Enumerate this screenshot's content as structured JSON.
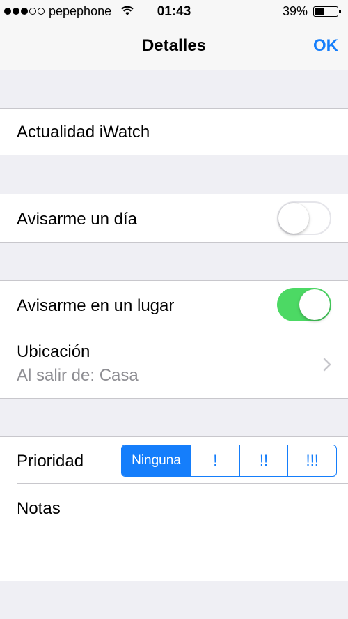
{
  "status_bar": {
    "carrier": "pepephone",
    "time": "01:43",
    "battery": "39%",
    "battery_level": 0.39,
    "signal_bars": 3,
    "signal_total": 5
  },
  "nav": {
    "title": "Detalles",
    "done_label": "OK"
  },
  "title_cell": {
    "text": "Actualidad iWatch"
  },
  "remind_day": {
    "label": "Avisarme un día",
    "on": false
  },
  "remind_location": {
    "label": "Avisarme en un lugar",
    "on": true,
    "location_label": "Ubicación",
    "location_value": "Al salir de: Casa"
  },
  "priority": {
    "label": "Prioridad",
    "options": [
      "Ninguna",
      "!",
      "!!",
      "!!!"
    ],
    "selected": "Ninguna"
  },
  "notes": {
    "label": "Notas"
  },
  "colors": {
    "accent": "#157efb",
    "toggle_on": "#4cd964",
    "background": "#efeff4"
  }
}
